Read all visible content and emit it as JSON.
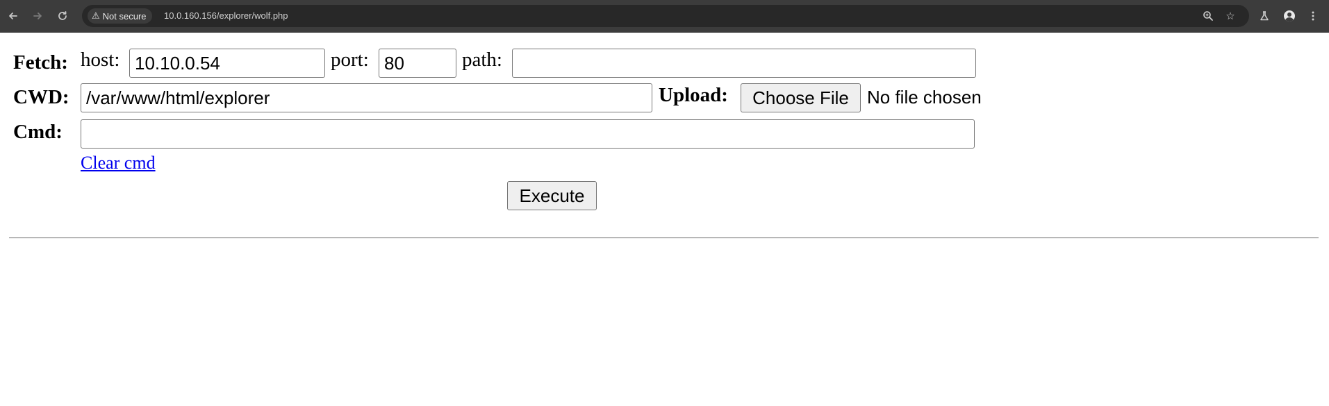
{
  "browser": {
    "security_label": "Not secure",
    "url": "10.0.160.156/explorer/wolf.php",
    "icons": {
      "back": "arrow-left-icon",
      "forward": "arrow-right-icon",
      "reload": "reload-icon",
      "warning": "warning-triangle-icon",
      "zoom": "zoom-icon",
      "bookmark": "star-icon",
      "labs": "flask-icon",
      "profile": "avatar-icon",
      "menu": "kebab-menu-icon"
    }
  },
  "form": {
    "fetch": {
      "label": "Fetch:",
      "host_label": "host:",
      "host_value": "10.10.0.54",
      "port_label": "port:",
      "port_value": "80",
      "path_label": "path:",
      "path_value": ""
    },
    "cwd": {
      "label": "CWD:",
      "value": "/var/www/html/explorer"
    },
    "upload": {
      "label": "Upload:",
      "button_label": "Choose File",
      "status": "No file chosen"
    },
    "cmd": {
      "label": "Cmd:",
      "value": ""
    },
    "clear_link": "Clear cmd",
    "execute_label": "Execute"
  }
}
